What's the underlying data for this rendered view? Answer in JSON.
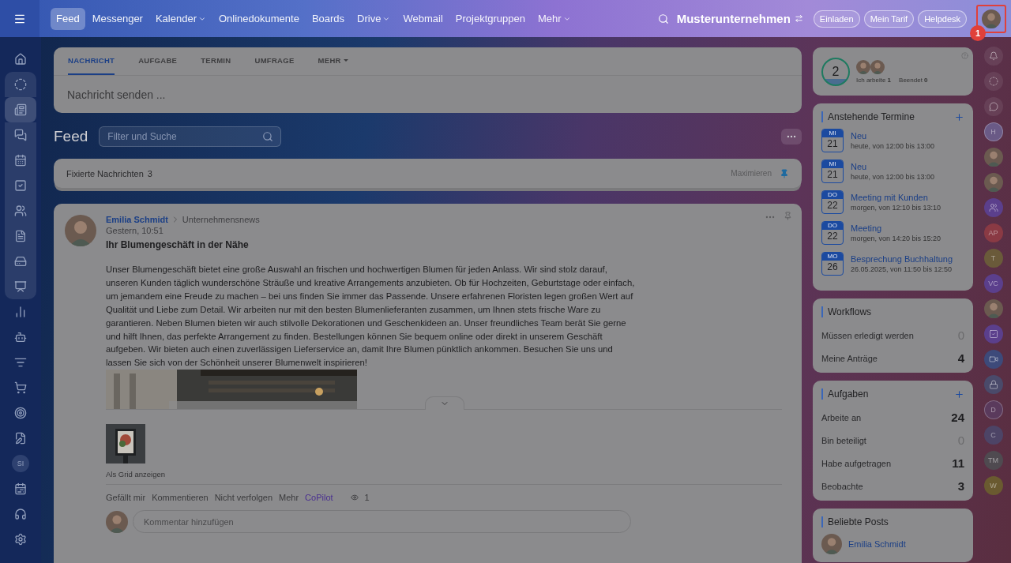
{
  "header": {
    "nav": [
      {
        "label": "Feed",
        "selected": true,
        "dropdown": false
      },
      {
        "label": "Messenger",
        "selected": false,
        "dropdown": false
      },
      {
        "label": "Kalender",
        "selected": false,
        "dropdown": true
      },
      {
        "label": "Onlinedokumente",
        "selected": false,
        "dropdown": false
      },
      {
        "label": "Boards",
        "selected": false,
        "dropdown": false
      },
      {
        "label": "Drive",
        "selected": false,
        "dropdown": true
      },
      {
        "label": "Webmail",
        "selected": false,
        "dropdown": false
      },
      {
        "label": "Projektgruppen",
        "selected": false,
        "dropdown": false
      },
      {
        "label": "Mehr",
        "selected": false,
        "dropdown": true
      }
    ],
    "company": "Musterunternehmen",
    "buttons": [
      "Einladen",
      "Mein Tarif",
      "Helpdesk"
    ],
    "tour_badge": "1"
  },
  "left_sidebar": {
    "items": [
      {
        "kind": "icon",
        "selected": false,
        "group": false
      },
      {
        "kind": "icon",
        "selected": false,
        "group": true
      },
      {
        "kind": "icon",
        "selected": true,
        "group": true
      },
      {
        "kind": "icon",
        "selected": false,
        "group": true
      },
      {
        "kind": "icon",
        "selected": false,
        "group": true
      },
      {
        "kind": "icon",
        "selected": false,
        "group": true
      },
      {
        "kind": "icon",
        "selected": false,
        "group": true
      },
      {
        "kind": "icon",
        "selected": false,
        "group": true
      },
      {
        "kind": "icon",
        "selected": false,
        "group": true
      },
      {
        "kind": "icon",
        "selected": false,
        "group": true
      },
      {
        "kind": "icon",
        "selected": false,
        "group": false
      },
      {
        "kind": "icon",
        "selected": false,
        "group": false
      },
      {
        "kind": "icon",
        "selected": false,
        "group": false
      },
      {
        "kind": "icon",
        "selected": false,
        "group": false
      },
      {
        "kind": "icon",
        "selected": false,
        "group": false
      },
      {
        "kind": "icon",
        "selected": false,
        "group": false
      },
      {
        "kind": "avatar",
        "label": "SI",
        "selected": false,
        "group": false
      },
      {
        "kind": "icon",
        "selected": false,
        "group": false
      },
      {
        "kind": "icon",
        "selected": false,
        "group": false
      },
      {
        "kind": "icon",
        "selected": false,
        "group": false
      }
    ]
  },
  "composer": {
    "tabs": [
      {
        "label": "NACHRICHT",
        "selected": true,
        "dropdown": false
      },
      {
        "label": "AUFGABE",
        "selected": false,
        "dropdown": false
      },
      {
        "label": "TERMIN",
        "selected": false,
        "dropdown": false
      },
      {
        "label": "UMFRAGE",
        "selected": false,
        "dropdown": false
      },
      {
        "label": "MEHR",
        "selected": false,
        "dropdown": true
      }
    ],
    "placeholder": "Nachricht senden ..."
  },
  "feed": {
    "title": "Feed",
    "search": {
      "placeholder": "Filter und Suche"
    },
    "pinned": {
      "label": "Fixierte Nachrichten",
      "count": "3",
      "action": "Maximieren"
    }
  },
  "post": {
    "author": "Emilia Schmidt",
    "target": "Unternehmensnews",
    "time": "Gestern, 10:51",
    "title": "Ihr Blumengeschäft in der Nähe",
    "body": "Unser Blumengeschäft bietet eine große Auswahl an frischen und hochwertigen Blumen für jeden Anlass. Wir sind stolz darauf, unseren Kunden täglich wunderschöne Sträuße und kreative Arrangements anzubieten. Ob für Hochzeiten, Geburtstage oder einfach, um jemandem eine Freude zu machen – bei uns finden Sie immer das Passende. Unsere erfahrenen Floristen legen großen Wert auf Qualität und Liebe zum Detail. Wir arbeiten nur mit den besten Blumenlieferanten zusammen, um Ihnen stets frische Ware zu garantieren. Neben Blumen bieten wir auch stilvolle Dekorationen und Geschenkideen an. Unser freundliches Team berät Sie gerne und hilft Ihnen, das perfekte Arrangement zu finden. Bestellungen können Sie bequem online oder direkt in unserem Geschäft aufgeben. Wir bieten auch einen zuverlässigen Lieferservice an, damit Ihre Blumen pünktlich ankommen. Besuchen Sie uns und lassen Sie sich von der Schönheit unserer Blumenwelt inspirieren!",
    "grid_link": "Als Grid anzeigen",
    "actions": [
      {
        "label": "Gefällt mir",
        "kind": "link"
      },
      {
        "label": "Kommentieren",
        "kind": "link"
      },
      {
        "label": "Nicht verfolgen",
        "kind": "link"
      },
      {
        "label": "Mehr",
        "kind": "link"
      },
      {
        "label": "CoPilot",
        "kind": "copilot"
      }
    ],
    "views": "1",
    "comment_placeholder": "Kommentar hinzufügen"
  },
  "status_widget": {
    "count": "2",
    "working_label": "Ich arbeite",
    "working": "1",
    "done_label": "Beendet",
    "done": "0"
  },
  "events": {
    "title": "Anstehende Termine",
    "items": [
      {
        "weekday": "MI",
        "day": "21",
        "title": "Neu",
        "time": "heute, von 12:00 bis 13:00"
      },
      {
        "weekday": "MI",
        "day": "21",
        "title": "Neu",
        "time": "heute, von 12:00 bis 13:00"
      },
      {
        "weekday": "DO",
        "day": "22",
        "title": "Meeting mit Kunden",
        "time": "morgen, von 12:10 bis 13:10"
      },
      {
        "weekday": "DO",
        "day": "22",
        "title": "Meeting",
        "time": "morgen, von 14:20 bis 15:20"
      },
      {
        "weekday": "MO",
        "day": "26",
        "title": "Besprechung Buchhaltung",
        "time": "26.05.2025, von 11:50 bis 12:50"
      }
    ]
  },
  "workflows": {
    "title": "Workflows",
    "rows": [
      {
        "label": "Müssen erledigt werden",
        "value": "0",
        "muted": true
      },
      {
        "label": "Meine Anträge",
        "value": "4",
        "muted": false
      }
    ]
  },
  "tasks": {
    "title": "Aufgaben",
    "rows": [
      {
        "label": "Arbeite an",
        "value": "24",
        "muted": false
      },
      {
        "label": "Bin beteiligt",
        "value": "0",
        "muted": true
      },
      {
        "label": "Habe aufgetragen",
        "value": "11",
        "muted": false
      },
      {
        "label": "Beobachte",
        "value": "3",
        "muted": false
      }
    ]
  },
  "popular": {
    "title": "Beliebte Posts",
    "author": "Emilia Schmidt"
  },
  "right_strip": {
    "items": [
      {
        "kind": "icon"
      },
      {
        "kind": "icon"
      },
      {
        "kind": "icon"
      },
      {
        "kind": "letter",
        "label": "H",
        "color": "#6a5a86",
        "outline": true
      },
      {
        "kind": "avatar"
      },
      {
        "kind": "avatar"
      },
      {
        "kind": "icon-circle",
        "color": "#5b3f8c"
      },
      {
        "kind": "letter",
        "label": "AP",
        "color": "#8a3a44",
        "outline": false
      },
      {
        "kind": "letter",
        "label": "T",
        "color": "#6a5a3a",
        "outline": false
      },
      {
        "kind": "letter",
        "label": "VC",
        "color": "#5b3f8c",
        "outline": false
      },
      {
        "kind": "avatar"
      },
      {
        "kind": "icon-circle",
        "color": "#5b3f8c"
      },
      {
        "kind": "icon-circle",
        "color": "#3d4a7a"
      },
      {
        "kind": "icon-circle",
        "color": "#4a4a6a"
      },
      {
        "kind": "letter",
        "label": "D",
        "color": "#5a3a5c",
        "outline": true
      },
      {
        "kind": "letter",
        "label": "C",
        "color": "#4d4466",
        "outline": false
      },
      {
        "kind": "letter",
        "label": "TM",
        "color": "#4f4a50",
        "outline": false
      },
      {
        "kind": "letter",
        "label": "W",
        "color": "#6a5a30",
        "outline": false
      }
    ]
  }
}
